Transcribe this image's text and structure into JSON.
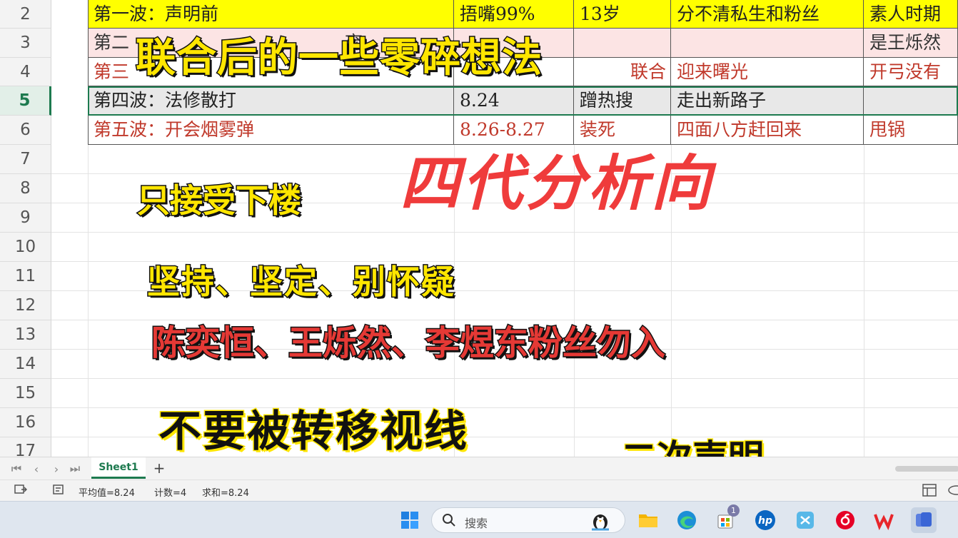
{
  "spreadsheet": {
    "rows": [
      {
        "num": "2",
        "cells": [
          "第一波：声明前",
          "捂嘴99%",
          "13岁",
          "分不清私生和粉丝",
          "素人时期"
        ]
      },
      {
        "num": "3",
        "cells": [
          "第二",
          "",
          "",
          "",
          "是王烁然"
        ]
      },
      {
        "num": "4",
        "cells": [
          "第三",
          "",
          "联合",
          "迎来曙光",
          "开弓没有"
        ]
      },
      {
        "num": "5",
        "cells": [
          "第四波：法修散打",
          "8.24",
          "蹭热搜",
          "走出新路子",
          ""
        ]
      },
      {
        "num": "6",
        "cells": [
          "第五波：开会烟雾弹",
          "8.26-8.27",
          "装死",
          "四面八方赶回来",
          "甩锅"
        ]
      }
    ],
    "empty_row_nums": [
      "7",
      "8",
      "9",
      "10",
      "11",
      "12",
      "13",
      "14",
      "15",
      "16",
      "17"
    ],
    "partial_row3_text": "弃",
    "active_row": "5"
  },
  "overlay": {
    "headline": "联合后的一些零碎想法",
    "big_red": "四代分析向",
    "line1": "只接受下楼",
    "line2": "坚持、坚定、别怀疑",
    "line3": "陈奕恒、王烁然、李煜东粉丝勿入",
    "line4": "不要被转移视线",
    "line5": "二次声明"
  },
  "sheet_tabs": {
    "active": "Sheet1",
    "add": "+"
  },
  "status": {
    "average": "平均值=8.24",
    "count": "计数=4",
    "sum": "求和=8.24"
  },
  "taskbar": {
    "search_placeholder": "搜索",
    "badge": "1"
  },
  "colors": {
    "accent_green": "#1d7a4f",
    "row2_fill": "#ffff00",
    "row3_fill": "#fce4e4",
    "red_text": "#c0392b"
  }
}
